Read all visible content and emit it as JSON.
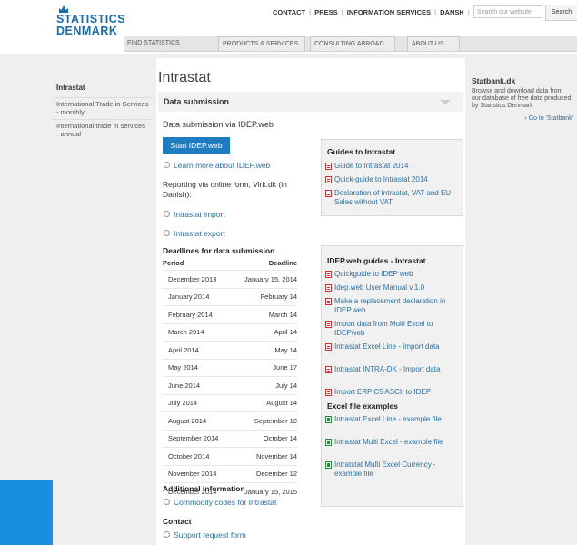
{
  "header": {
    "logo_line1": "STATISTICS",
    "logo_line2": "DENMARK",
    "top_links": [
      "CONTACT",
      "PRESS",
      "INFORMATION SERVICES",
      "DANSK"
    ],
    "search_placeholder": "Search our website",
    "search_button": "Search"
  },
  "nav": {
    "tabs": [
      "FIND STATISTICS",
      "PRODUCTS & SERVICES",
      "CONSULTING ABROAD",
      "ABOUT US"
    ]
  },
  "sidebar": {
    "heading": "Intrastat",
    "items": [
      "International Trade in Services - monthly",
      "International trade in services - annual"
    ]
  },
  "main": {
    "title": "Intrastat",
    "section_title": "Data submission",
    "submission_text": "Data submission via IDEP.web",
    "start_button": "Start IDEP.web",
    "learn_more": "Learn more about IDEP.web",
    "online_form_text": "Reporting via online form, Virk.dk (in Danish):",
    "import_link": "Intrastat import",
    "export_link": "Intrastat export",
    "deadlines": {
      "heading": "Deadlines for data submission",
      "col_period": "Period",
      "col_deadline": "Deadline",
      "rows": [
        [
          "December 2013",
          "January 15, 2014"
        ],
        [
          "January 2014",
          "February 14"
        ],
        [
          "February 2014",
          "March 14"
        ],
        [
          "March 2014",
          "April 14"
        ],
        [
          "April 2014",
          "May 14"
        ],
        [
          "May 2014",
          "June 17"
        ],
        [
          "June 2014",
          "July 14"
        ],
        [
          "July 2014",
          "August 14"
        ],
        [
          "August 2014",
          "September 12"
        ],
        [
          "September 2014",
          "October 14"
        ],
        [
          "October 2014",
          "November 14"
        ],
        [
          "November 2014",
          "December 12"
        ],
        [
          "December 2014",
          "January 15, 2015"
        ]
      ]
    },
    "additional_heading": "Additional information",
    "commodity_link": "Commodity codes for Intrastat",
    "contact_heading": "Contact",
    "support_link": "Support request form"
  },
  "guides": {
    "title": "Guides to Intrastat",
    "links": [
      "Guide to Intrastat 2014",
      "Quick-guide to Intrastat 2014",
      "Declaration of Intrastat, VAT and EU Sales without VAT"
    ]
  },
  "idep_guides": {
    "title": "IDEP.web guides - Intrastat",
    "links": [
      "Quickguide to IDEP web",
      "Idep.web User Manual v.1.0",
      "Make a replacement declaration in IDEP.web",
      "Import data from Multi Excel to IDEPweb",
      "Intrastat Excel Line - Import data",
      "Intrastat INTRA-DK - Import data",
      "Import ERP C5 ASCII to IDEP"
    ],
    "excel_heading": "Excel file examples",
    "excel_links": [
      "Intrastat Excel Line - example file",
      "Intrastat Multi Excel - example file",
      "Intratstat Multi Excel Currency - example file"
    ]
  },
  "statbank": {
    "title": "Statbank.dk",
    "text": "Browse and download data from our database of free data produced by Statistics Denmark",
    "link": "› Go to 'Statbank'"
  }
}
